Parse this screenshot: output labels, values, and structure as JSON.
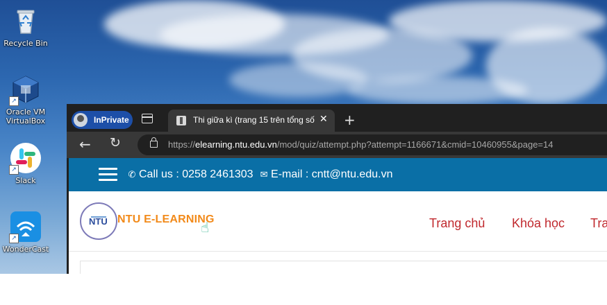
{
  "desktop": {
    "icons": [
      {
        "name": "recycle-bin",
        "label": "Recycle Bin"
      },
      {
        "name": "oracle-vm-virtualbox",
        "label": "Oracle VM VirtualBox"
      },
      {
        "name": "slack",
        "label": "Slack"
      },
      {
        "name": "wondercast",
        "label": "WonderCast"
      }
    ]
  },
  "browser": {
    "inprivate_label": "InPrivate",
    "tab_title": "Thi giữa kì (trang 15 trên tổng số",
    "tab_close": "✕",
    "new_tab": "+",
    "url_prefix": "https://",
    "url_host": "elearning.ntu.edu.vn",
    "url_path": "/mod/quiz/attempt.php?attempt=1166671&cmid=10460955&page=14"
  },
  "site": {
    "topbar": {
      "call_text": "Call us : 0258 2461303",
      "email_text": "E-mail : cntt@ntu.edu.vn"
    },
    "logo_text": "NTU",
    "brand": "NTU E-LEARNING",
    "nav": [
      "Trang chủ",
      "Khóa học",
      "Tra"
    ]
  },
  "icons": {
    "phone": "phone-icon",
    "email": "envelope-icon",
    "hand": "pointing-hand-icon"
  }
}
